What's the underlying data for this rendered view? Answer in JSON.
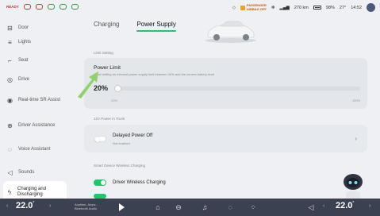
{
  "status_bar": {
    "left_tags": [
      "READY"
    ],
    "passenger_airbag": [
      "PASSENGER",
      "AIRBAG OFF"
    ],
    "range": "270 km",
    "battery_pct": "98%",
    "temperature": "27°",
    "time": "14:52"
  },
  "sidebar": {
    "items": [
      {
        "label": "Door",
        "icon": "door-icon"
      },
      {
        "label": "Lights",
        "icon": "lights-icon"
      },
      {
        "label": "Seat",
        "icon": "seat-icon"
      },
      {
        "label": "Drive",
        "icon": "drive-icon"
      },
      {
        "label": "Real-time SR Assist",
        "icon": "sr-assist-icon"
      },
      {
        "label": "Driver Assistance",
        "icon": "driver-assistance-icon"
      },
      {
        "label": "Voice Assistant",
        "icon": "voice-assistant-icon"
      },
      {
        "label": "Sounds",
        "icon": "sounds-icon"
      },
      {
        "label": "Charging and Discharging",
        "icon": "charging-icon"
      }
    ]
  },
  "tabs": [
    "Charging",
    "Power Supply"
  ],
  "limit_section": {
    "section_label": "Limit Setting",
    "title": "Power Limit",
    "description": "Allow setting an external power supply limit between 20% and the current battery level",
    "value": "20%",
    "tick_min": "20%",
    "tick_max": "100%"
  },
  "trunk_section": {
    "section_label": "12V Power in Trunk",
    "title": "Delayed Power Off",
    "subtitle": "Not enabled"
  },
  "wireless_section": {
    "section_label": "Smart Device Wireless Charging",
    "items": [
      "Driver Wireless Charging"
    ]
  },
  "dock": {
    "left_temp": "22.0",
    "right_temp": "22.0",
    "media_title": "Anytime, Anyw...",
    "media_sub": "Bluetooth Audio"
  },
  "colors": {
    "accent": "#1fc76a",
    "callout_arrow": "#8dd26a",
    "dock_bg": "#3b4150"
  }
}
